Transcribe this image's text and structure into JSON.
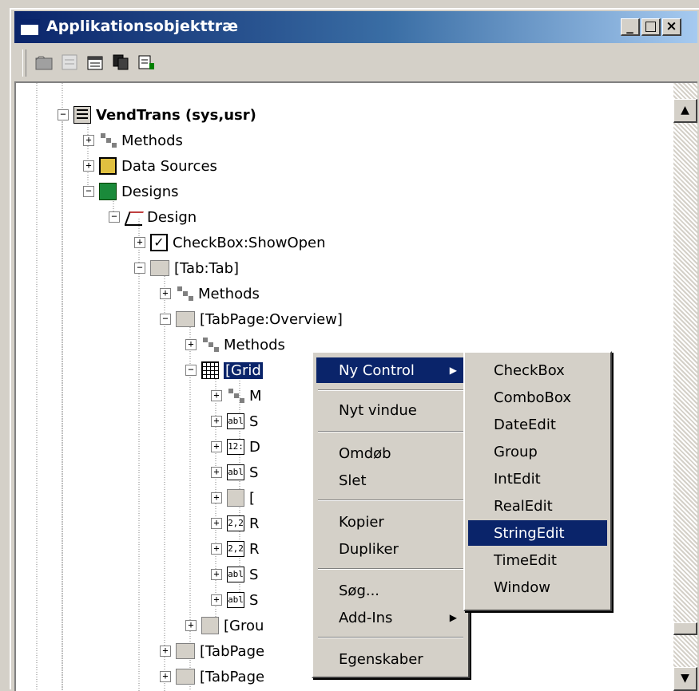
{
  "window": {
    "title": "Applikationsobjekttræ",
    "minimize_label": "_",
    "maximize_label": "□",
    "close_label": "×"
  },
  "toolbar": {
    "icons": [
      "open-icon",
      "properties-disabled-icon",
      "properties-icon",
      "copy-icon",
      "compile-icon"
    ]
  },
  "tree": {
    "root_label": "VendTrans (sys,usr)",
    "items": [
      {
        "label": "Methods",
        "icon": "methods-icon"
      },
      {
        "label": "Data Sources",
        "icon": "data-sources-icon"
      },
      {
        "label": "Designs",
        "icon": "designs-icon"
      },
      {
        "label": "Design",
        "icon": "design-icon"
      },
      {
        "label": "CheckBox:ShowOpen",
        "icon": "checkbox-icon"
      },
      {
        "label": "[Tab:Tab]",
        "icon": "tab-icon"
      },
      {
        "label": "Methods",
        "icon": "methods-icon"
      },
      {
        "label": "[TabPage:Overview]",
        "icon": "tabpage-icon"
      },
      {
        "label": "Methods",
        "icon": "methods-icon"
      },
      {
        "label": "[Grid",
        "icon": "grid-icon"
      },
      {
        "label": "M",
        "icon": "methods-icon"
      },
      {
        "label": "S",
        "icon": "stringedit-icon"
      },
      {
        "label": "D",
        "icon": "dateedit-icon"
      },
      {
        "label": "S",
        "icon": "stringedit-icon"
      },
      {
        "label": "[",
        "icon": "group-icon"
      },
      {
        "label": "R",
        "icon": "realedit-icon"
      },
      {
        "label": "R",
        "icon": "realedit-icon"
      },
      {
        "label": "S",
        "icon": "stringedit-icon"
      },
      {
        "label": "S",
        "icon": "stringedit-icon"
      },
      {
        "label": "[Grou",
        "icon": "group-icon"
      },
      {
        "label": "[TabPage",
        "icon": "tabpage-icon"
      },
      {
        "label": "[TabPage",
        "icon": "tabpage-icon"
      }
    ],
    "icon_text": {
      "abl": "abl",
      "date": "12:",
      "real": "2,2"
    }
  },
  "context_menu": {
    "items": [
      "Ny Control",
      "Nyt vindue",
      "Omdøb",
      "Slet",
      "Kopier",
      "Dupliker",
      "Søg...",
      "Add-Ins",
      "Egenskaber"
    ],
    "submenu_arrow": "▶"
  },
  "submenu": {
    "items": [
      "CheckBox",
      "ComboBox",
      "DateEdit",
      "Group",
      "IntEdit",
      "RealEdit",
      "StringEdit",
      "TimeEdit",
      "Window"
    ],
    "highlighted": "StringEdit"
  },
  "colors": {
    "title_start": "#0a246a",
    "title_end": "#a6caf0",
    "highlight": "#0a246a",
    "face": "#d4d0c8"
  }
}
